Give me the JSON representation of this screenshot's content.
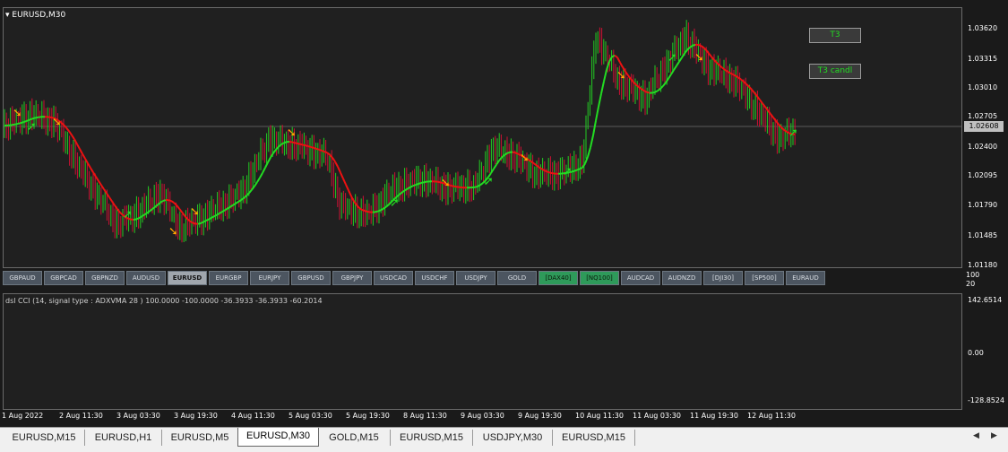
{
  "chart": {
    "symbol_label": "EURUSD,M30",
    "price_ticks": [
      "1.03620",
      "1.03315",
      "1.03010",
      "1.02705",
      "1.02400",
      "1.02095",
      "1.01790",
      "1.01485",
      "1.01180"
    ],
    "current_price": "1.02608",
    "buttons": {
      "t3": "T3",
      "t3_candl": "T3 candl"
    },
    "colors": {
      "bull": "#22cc22",
      "bear": "#cc1133",
      "arrow_orange": "#ffa500",
      "arrow_green": "#22dd22",
      "t3_up": "#22dd22",
      "t3_down": "#ee1111"
    }
  },
  "symbols": [
    "GBPAUD",
    "GBPCAD",
    "GBPNZD",
    "AUDUSD",
    "EURUSD",
    "EURGBP",
    "EURJPY",
    "GBPUSD",
    "GBPJPY",
    "USDCAD",
    "USDCHF",
    "USDJPY",
    "GOLD",
    "[DAX40]",
    "[NQ100]",
    "AUDCAD",
    "AUDNZD",
    "[DJI30]",
    "[SP500]",
    "EURAUD"
  ],
  "symbol_active": "EURUSD",
  "symbar_right": [
    "100",
    "20"
  ],
  "indicator": {
    "label": "dsl CCI  (14, signal type : ADXVMA  28 ) 100.0000 -100.0000 -36.3933 -36.3933 -60.2014",
    "ticks": [
      "142.6514",
      "0.00",
      "-128.8524"
    ]
  },
  "time_ticks": [
    "1 Aug 2022",
    "2 Aug 11:30",
    "3 Aug 03:30",
    "3 Aug 19:30",
    "4 Aug 11:30",
    "5 Aug 03:30",
    "5 Aug 19:30",
    "8 Aug 11:30",
    "9 Aug 03:30",
    "9 Aug 19:30",
    "10 Aug 11:30",
    "11 Aug 03:30",
    "11 Aug 19:30",
    "12 Aug 11:30"
  ],
  "tabs": [
    "EURUSD,M15",
    "EURUSD,H1",
    "EURUSD,M5",
    "EURUSD,M30",
    "GOLD,M15",
    "EURUSD,M15",
    "USDJPY,M30",
    "EURUSD,M15"
  ],
  "active_tab": "EURUSD,M30"
}
